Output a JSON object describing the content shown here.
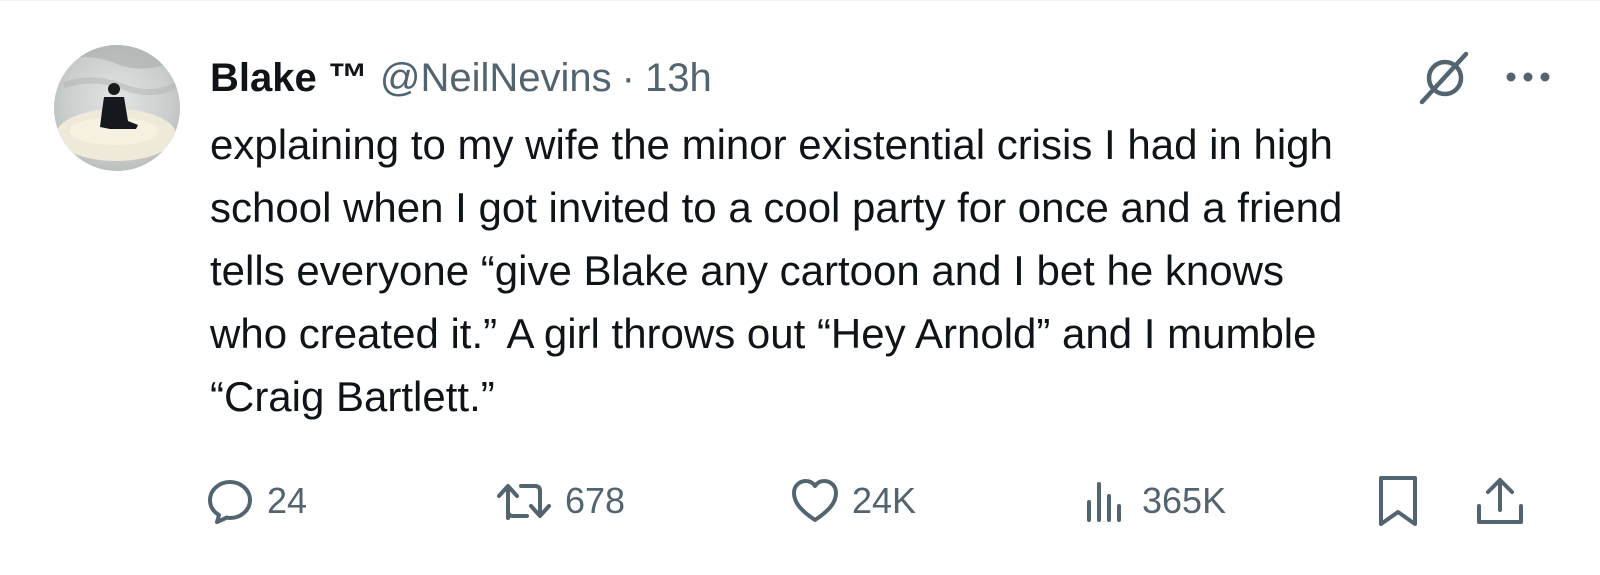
{
  "author": {
    "display_name": "Blake ™",
    "handle": "@NeilNevins",
    "separator": "·",
    "time": "13h"
  },
  "tweet": {
    "text": "explaining to my wife the minor existential crisis I had in high\nschool when I got invited to a cool party for once and a friend\ntells everyone “give Blake any cartoon and I bet he knows\nwho created it.” A girl throws out “Hey Arnold” and I mumble\n“Craig Bartlett.”"
  },
  "actions": {
    "replies": "24",
    "reposts": "678",
    "likes": "24K",
    "views": "365K"
  },
  "icons": {
    "header": [
      "grok-icon",
      "more-icon"
    ],
    "actions": [
      "reply-icon",
      "repost-icon",
      "like-icon",
      "views-icon",
      "bookmark-icon",
      "share-icon"
    ]
  },
  "colors": {
    "text_primary": "#0f1419",
    "text_secondary": "#536471",
    "background": "#ffffff"
  }
}
